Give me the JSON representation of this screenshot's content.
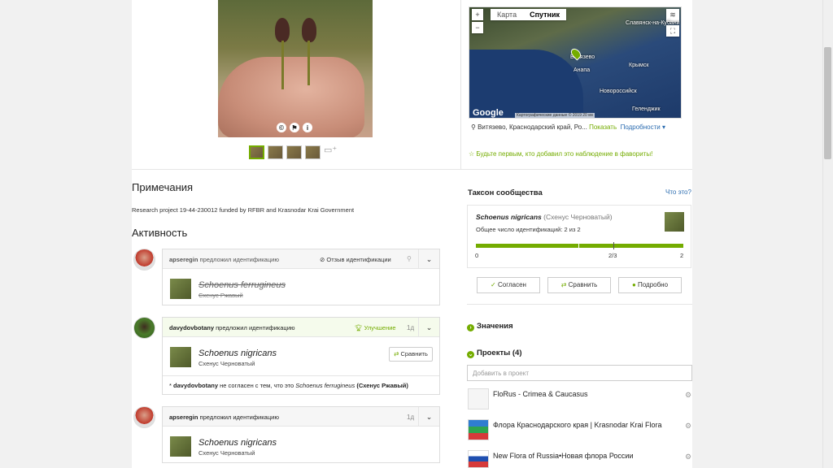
{
  "photo": {
    "actions": [
      "©",
      "⚑",
      "i"
    ]
  },
  "map": {
    "zoom_in": "+",
    "zoom_out": "−",
    "tabs": [
      "Карта",
      "Спутник"
    ],
    "active_tab": "Спутник",
    "labels": [
      "Славянск-на-Кубани",
      "Крымск",
      "Анапа",
      "Витязево",
      "Новороссийск",
      "Геленджик"
    ],
    "google": "Google",
    "footer": "Картографические данные © 2019   20 км",
    "location": "Витязево, Краснодарский край, Ро...",
    "show_link": "Показать",
    "details_link": "Подробности ▾"
  },
  "favorite_text": "Будьте первым, кто добавил это наблюдение в фавориты!",
  "notes": {
    "title": "Примечания",
    "text": "Research project 19-44-230012 funded by RFBR and Krasnodar Krai Government"
  },
  "activity": {
    "title": "Активность",
    "items": [
      {
        "user": "apseregin",
        "action": "предложил идентификацию",
        "status": "Отзыв идентификации",
        "taxon": "Schoenus ferrugineus",
        "common": "Схенус Ржавый"
      },
      {
        "user": "davydovbotany",
        "action": "предложил идентификацию",
        "status": "Улучшение",
        "date": "1д",
        "taxon": "Schoenus nigricans",
        "common": "Схенус Черноватый",
        "compare": "Сравнить",
        "disagree_user": "davydovbotany",
        "disagree_text": "не согласен с тем, что это",
        "disagree_taxon": "Schoenus ferrugineus",
        "disagree_common": "(Схенус Ржавый)"
      },
      {
        "user": "apseregin",
        "action": "предложил идентификацию",
        "date": "1д",
        "taxon": "Schoenus nigricans",
        "common": "Схенус Черноватый"
      }
    ]
  },
  "community_taxon": {
    "title": "Таксон сообщества",
    "whats_this": "Что это?",
    "taxon": "Schoenus nigricans",
    "common": "(Схенус Черноватый)",
    "id_count": "Общее число идентификаций: 2 из 2",
    "scale_min": "0",
    "scale_mid": "2/3",
    "scale_max": "2",
    "buttons": [
      "Согласен",
      "Сравнить",
      "Подробно"
    ]
  },
  "values_section": "Значения",
  "projects": {
    "title": "Проекты (4)",
    "add_placeholder": "Добавить в проект",
    "items": [
      "FloRus - Crimea & Caucasus",
      "Флора Краснодарского края | Krasnodar Krai Flora",
      "New Flora of Russia•Новая флора России"
    ]
  }
}
